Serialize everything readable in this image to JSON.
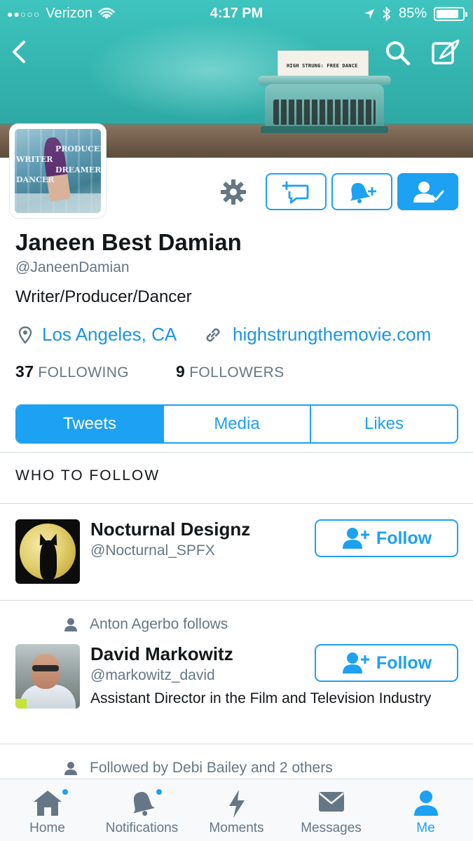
{
  "status_bar": {
    "carrier": "Verizon",
    "signal_dots": "●●○○○",
    "time": "4:17 PM",
    "battery_text": "85%",
    "battery_level": 0.85
  },
  "header": {
    "banner_paper_text": "HIGH STRUNG: FREE DANCE",
    "back_icon": "chevron-left-icon",
    "search_icon": "search-icon",
    "compose_icon": "compose-icon"
  },
  "avatar_text": [
    "PRODUCER",
    "WRITER",
    "DREAMER",
    "DANCER"
  ],
  "profile": {
    "name": "Janeen Best Damian",
    "handle": "@JaneenDamian",
    "bio": "Writer/Producer/Dancer",
    "location": "Los Angeles, CA",
    "url": "highstrungthemovie.com",
    "following_count": "37",
    "following_label": "FOLLOWING",
    "followers_count": "9",
    "followers_label": "FOLLOWERS"
  },
  "tabs": [
    {
      "label": "Tweets",
      "active": true
    },
    {
      "label": "Media",
      "active": false
    },
    {
      "label": "Likes",
      "active": false
    }
  ],
  "who_to_follow": {
    "title": "WHO TO FOLLOW",
    "follow_label": "Follow",
    "suggestions": [
      {
        "name": "Nocturnal Designz",
        "handle": "@Nocturnal_SPFX",
        "bio": ""
      },
      {
        "context": "Anton Agerbo follows",
        "name": "David Markowitz",
        "handle": "@markowitz_david",
        "bio": "Assistant Director in the Film and Television Industry"
      }
    ],
    "next_context": "Followed by Debi Bailey and 2 others"
  },
  "tabbar": [
    {
      "label": "Home",
      "icon": "home-icon",
      "badge": true
    },
    {
      "label": "Notifications",
      "icon": "bell-icon",
      "badge": true
    },
    {
      "label": "Moments",
      "icon": "lightning-icon",
      "badge": false
    },
    {
      "label": "Messages",
      "icon": "envelope-icon",
      "badge": false
    },
    {
      "label": "Me",
      "icon": "person-icon",
      "badge": false
    }
  ],
  "colors": {
    "accent": "#1da1f2",
    "secondary_text": "#657786",
    "link": "#1b95e0",
    "banner_teal": "#35b6b0"
  }
}
